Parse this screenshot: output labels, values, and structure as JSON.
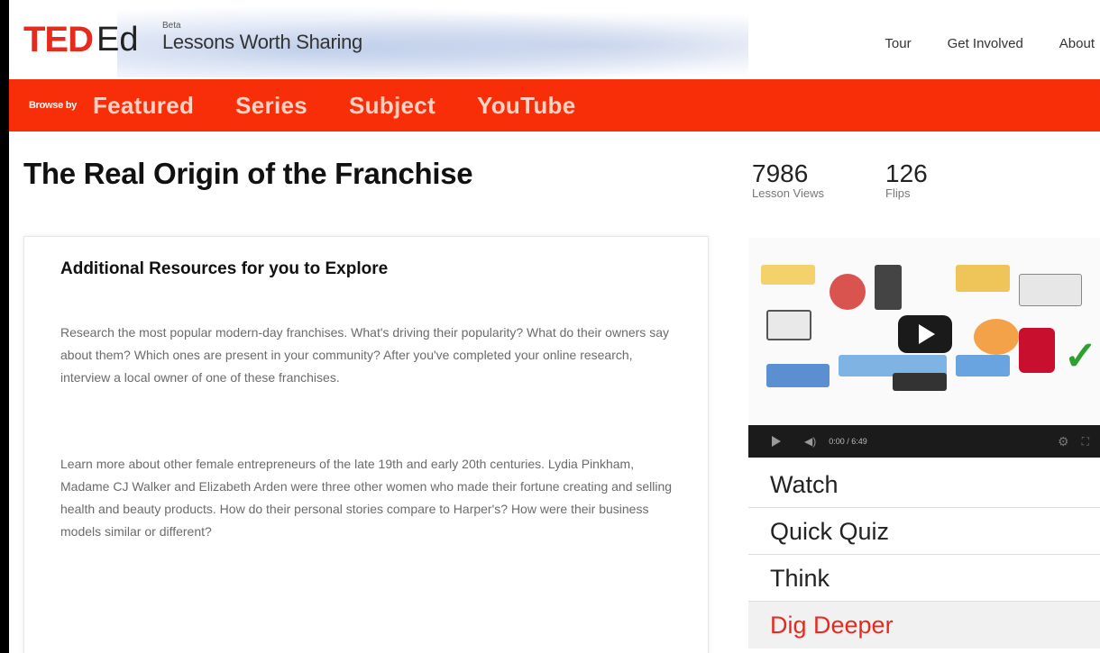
{
  "header": {
    "logo_ted": "TED",
    "logo_ed": "Ed",
    "beta": "Beta",
    "tagline": "Lessons Worth Sharing",
    "nav": [
      "Tour",
      "Get Involved",
      "About"
    ]
  },
  "browse": {
    "label": "Browse by",
    "items": [
      "Featured",
      "Series",
      "Subject",
      "YouTube"
    ]
  },
  "lesson": {
    "title": "The Real Origin of the Franchise",
    "stats": {
      "views": "7986",
      "views_label": "Lesson Views",
      "flips": "126",
      "flips_label": "Flips"
    }
  },
  "resources": {
    "heading": "Additional Resources for you to Explore",
    "paragraphs": [
      "Research the most popular modern-day franchises.  What's driving their popularity?  What do their owners say about them?  Which ones are present in your community?  After you've completed your online research, interview a local owner of one of these franchises.",
      "Learn more about other female entrepreneurs of the late 19th and early 20th centuries. Lydia Pinkham, Madame CJ Walker and Elizabeth Arden were three other women who made their fortune creating and selling health and beauty products. How do their personal stories compare to Harper's?  How were their business models similar or different?"
    ]
  },
  "video": {
    "time": "0:00 / 6:49",
    "icons": {
      "play": "play-icon",
      "volume": "volume-icon",
      "settings": "gear-icon",
      "fullscreen": "fullscreen-icon"
    }
  },
  "menu": {
    "items": [
      "Watch",
      "Quick Quiz",
      "Think",
      "Dig Deeper"
    ],
    "active_index": 3
  },
  "colors": {
    "brand_red": "#e62b1e",
    "browse_bar": "#f72e08",
    "browse_text": "#ffd2c4"
  }
}
